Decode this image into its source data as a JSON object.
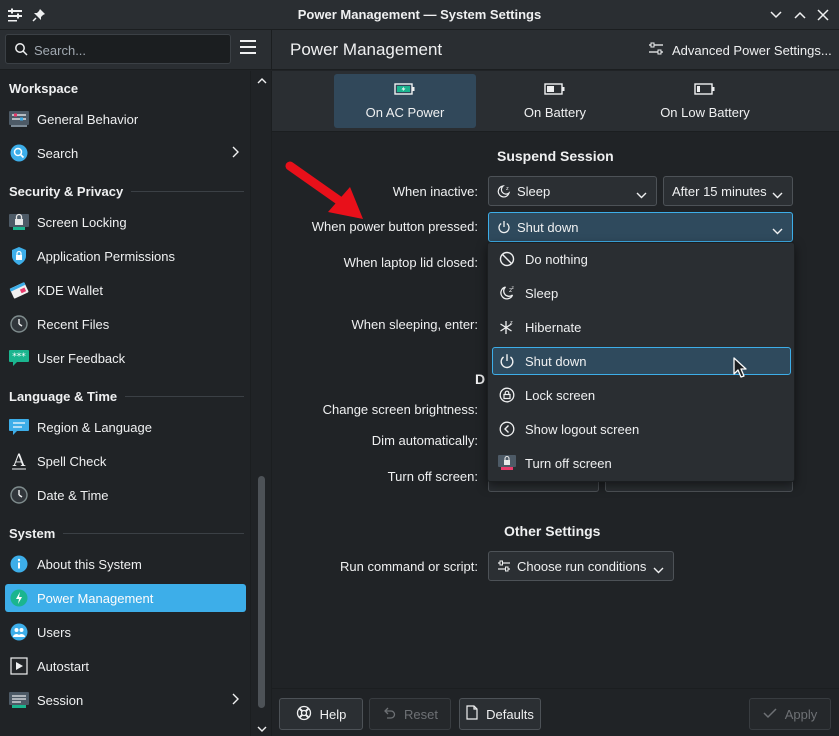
{
  "window": {
    "title": "Power Management — System Settings"
  },
  "toolbar": {
    "search_placeholder": "Search...",
    "page_title": "Power Management",
    "advanced_label": "Advanced Power Settings..."
  },
  "sidebar": {
    "sections": [
      {
        "title": "Workspace"
      },
      {
        "title": "Security & Privacy"
      },
      {
        "title": "Language & Time"
      },
      {
        "title": "System"
      }
    ],
    "items": [
      {
        "label": "General Behavior"
      },
      {
        "label": "Search"
      },
      {
        "label": "Screen Locking"
      },
      {
        "label": "Application Permissions"
      },
      {
        "label": "KDE Wallet"
      },
      {
        "label": "Recent Files"
      },
      {
        "label": "User Feedback"
      },
      {
        "label": "Region & Language"
      },
      {
        "label": "Spell Check"
      },
      {
        "label": "Date & Time"
      },
      {
        "label": "About this System"
      },
      {
        "label": "Power Management"
      },
      {
        "label": "Users"
      },
      {
        "label": "Autostart"
      },
      {
        "label": "Session"
      }
    ]
  },
  "tabs": [
    {
      "label": "On AC Power"
    },
    {
      "label": "On Battery"
    },
    {
      "label": "On Low Battery"
    }
  ],
  "suspend": {
    "heading": "Suspend Session",
    "when_inactive_label": "When inactive:",
    "when_inactive_value": "Sleep",
    "after_value": "After 15 minutes",
    "power_button_label": "When power button pressed:",
    "power_button_value": "Shut down",
    "lid_label": "When laptop lid closed:",
    "sleeping_label": "When sleeping, enter:"
  },
  "display": {
    "heading_partial": "D",
    "brightness_label": "Change screen brightness:",
    "dim_label": "Dim automatically:",
    "turn_off_label": "Turn off screen:"
  },
  "other": {
    "heading": "Other Settings",
    "run_label": "Run command or script:",
    "run_value": "Choose run conditions"
  },
  "dropdown": {
    "options": [
      {
        "label": "Do nothing"
      },
      {
        "label": "Sleep"
      },
      {
        "label": "Hibernate"
      },
      {
        "label": "Shut down"
      },
      {
        "label": "Lock screen"
      },
      {
        "label": "Show logout screen"
      },
      {
        "label": "Turn off screen"
      }
    ]
  },
  "buttons": {
    "help": "Help",
    "reset": "Reset",
    "defaults": "Defaults",
    "apply": "Apply"
  },
  "colors": {
    "accent": "#3daee9",
    "background": "#202326",
    "highlight": "#2f4a5d",
    "arrow": "#e8101a"
  }
}
